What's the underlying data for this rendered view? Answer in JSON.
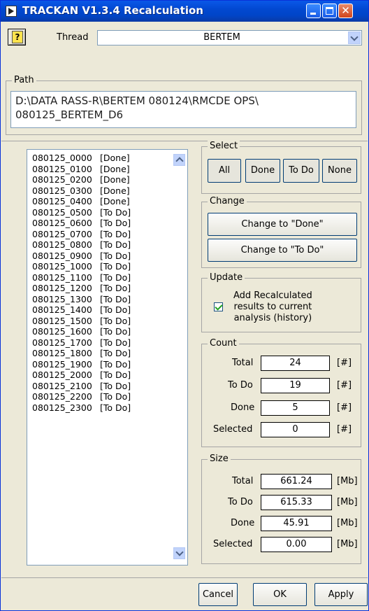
{
  "window": {
    "title": "TRACKAN V1.3.4 Recalculation"
  },
  "header": {
    "help_label": "?",
    "thread_label": "Thread",
    "thread_value": "BERTEM"
  },
  "path": {
    "legend": "Path",
    "value_line1": "D:\\DATA RASS-R\\BERTEM 080124\\RMCDE OPS\\",
    "value_line2": "080125_BERTEM_D6"
  },
  "list": {
    "rows": [
      {
        "id": "080125_0000",
        "status": "[Done]"
      },
      {
        "id": "080125_0100",
        "status": "[Done]"
      },
      {
        "id": "080125_0200",
        "status": "[Done]"
      },
      {
        "id": "080125_0300",
        "status": "[Done]"
      },
      {
        "id": "080125_0400",
        "status": "[Done]"
      },
      {
        "id": "080125_0500",
        "status": "[To Do]"
      },
      {
        "id": "080125_0600",
        "status": "[To Do]"
      },
      {
        "id": "080125_0700",
        "status": "[To Do]"
      },
      {
        "id": "080125_0800",
        "status": "[To Do]"
      },
      {
        "id": "080125_0900",
        "status": "[To Do]"
      },
      {
        "id": "080125_1000",
        "status": "[To Do]"
      },
      {
        "id": "080125_1100",
        "status": "[To Do]"
      },
      {
        "id": "080125_1200",
        "status": "[To Do]"
      },
      {
        "id": "080125_1300",
        "status": "[To Do]"
      },
      {
        "id": "080125_1400",
        "status": "[To Do]"
      },
      {
        "id": "080125_1500",
        "status": "[To Do]"
      },
      {
        "id": "080125_1600",
        "status": "[To Do]"
      },
      {
        "id": "080125_1700",
        "status": "[To Do]"
      },
      {
        "id": "080125_1800",
        "status": "[To Do]"
      },
      {
        "id": "080125_1900",
        "status": "[To Do]"
      },
      {
        "id": "080125_2000",
        "status": "[To Do]"
      },
      {
        "id": "080125_2100",
        "status": "[To Do]"
      },
      {
        "id": "080125_2200",
        "status": "[To Do]"
      },
      {
        "id": "080125_2300",
        "status": "[To Do]"
      }
    ]
  },
  "select": {
    "legend": "Select",
    "all": "All",
    "done": "Done",
    "todo": "To Do",
    "none": "None"
  },
  "change": {
    "legend": "Change",
    "to_done": "Change to \"Done\"",
    "to_todo": "Change to \"To Do\""
  },
  "update": {
    "legend": "Update",
    "line1": "Add Recalculated",
    "line2": "results to current",
    "line3": "analysis (history)",
    "checked": true
  },
  "count": {
    "legend": "Count",
    "total_label": "Total",
    "total": "24",
    "todo_label": "To Do",
    "todo": "19",
    "done_label": "Done",
    "done": "5",
    "selected_label": "Selected",
    "selected": "0",
    "unit": "[#]"
  },
  "size": {
    "legend": "Size",
    "total_label": "Total",
    "total": "661.24",
    "todo_label": "To Do",
    "todo": "615.33",
    "done_label": "Done",
    "done": "45.91",
    "selected_label": "Selected",
    "selected": "0.00",
    "unit": "[Mb]"
  },
  "footer": {
    "cancel": "Cancel",
    "ok": "OK",
    "apply": "Apply"
  }
}
